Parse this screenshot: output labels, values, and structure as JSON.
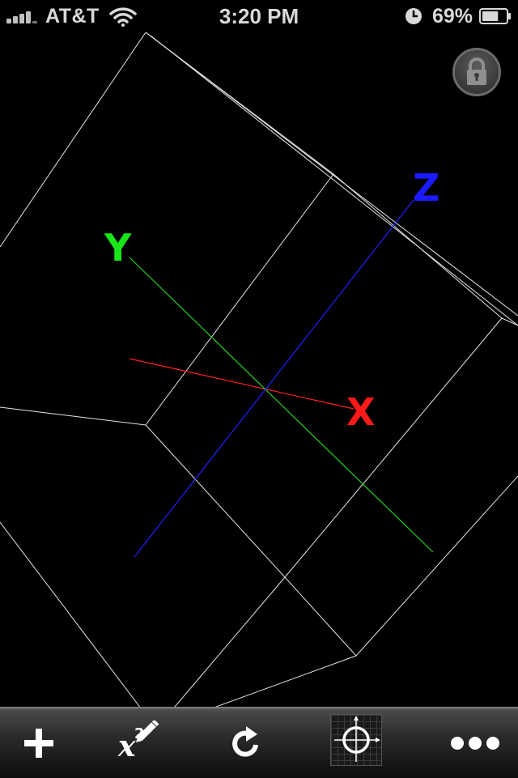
{
  "status_bar": {
    "carrier": "AT&T",
    "time": "3:20 PM",
    "battery_percent": "69%",
    "icons": {
      "signal": "signal-strength-icon",
      "wifi": "wifi-icon",
      "alarm": "alarm-clock-icon",
      "battery": "battery-icon"
    },
    "battery_level": 0.69
  },
  "viewport": {
    "axis_labels": {
      "x": "X",
      "y": "Y",
      "z": "Z"
    },
    "axis_colors": {
      "x": "#ff1a1a",
      "y": "#19e619",
      "z": "#1a1aff"
    },
    "wireframe_color": "#ffffff",
    "background_color": "#000000"
  },
  "lock_button": {
    "icon": "padlock-icon"
  },
  "toolbar": {
    "buttons": [
      {
        "name": "add-button",
        "icon": "plus-icon"
      },
      {
        "name": "formula-edit-button",
        "icon": "x-squared-pencil-icon"
      },
      {
        "name": "rotate-button",
        "icon": "rotate-arrow-icon"
      },
      {
        "name": "center-view-button",
        "icon": "crosshair-icon"
      },
      {
        "name": "more-button",
        "icon": "ellipsis-icon"
      }
    ],
    "formula_icon_text": {
      "base": "x",
      "exponent": "2"
    }
  }
}
